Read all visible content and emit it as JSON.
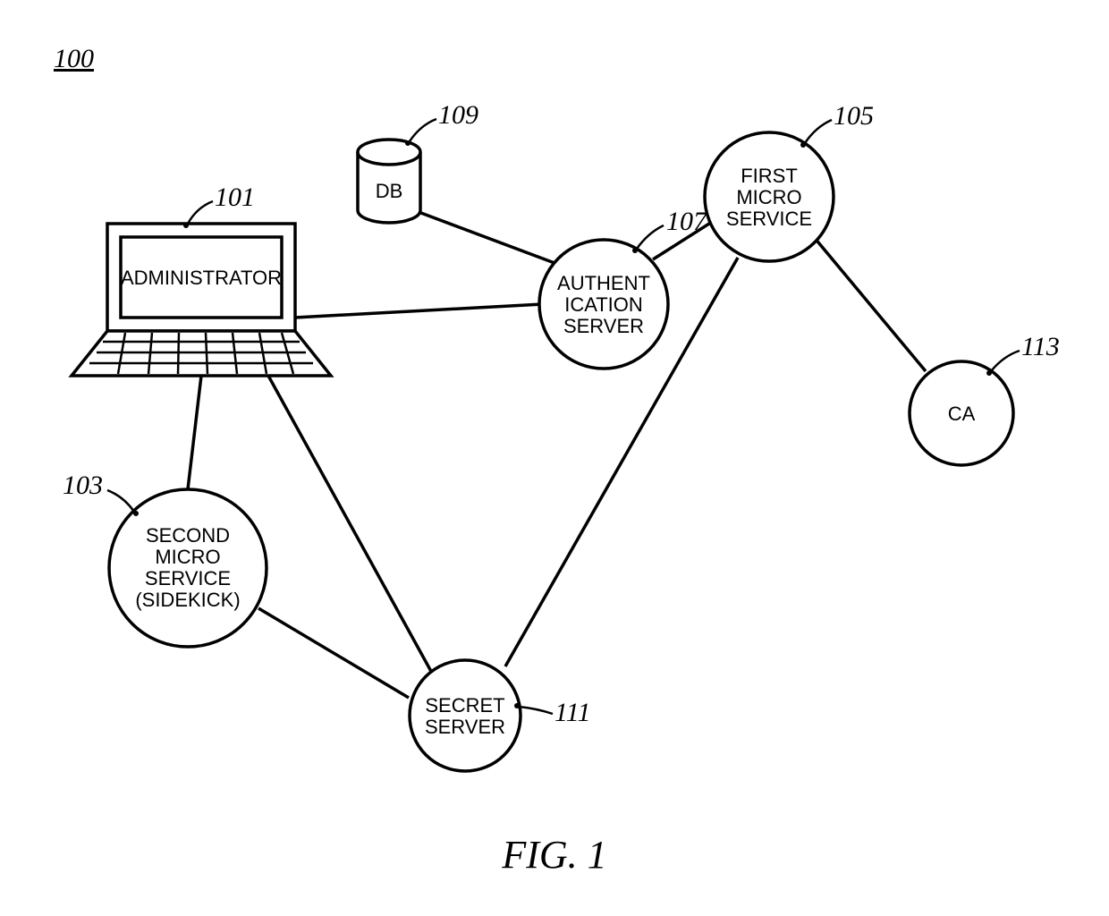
{
  "figure": {
    "number_ref": "100",
    "caption": "FIG. 1"
  },
  "nodes": {
    "administrator": {
      "ref": "101",
      "label": "ADMINISTRATOR"
    },
    "second_micro": {
      "ref": "103",
      "line1": "SECOND",
      "line2": "MICRO",
      "line3": "SERVICE",
      "line4": "(SIDEKICK)"
    },
    "first_micro": {
      "ref": "105",
      "line1": "FIRST",
      "line2": "MICRO",
      "line3": "SERVICE"
    },
    "auth_server": {
      "ref": "107",
      "line1": "AUTHENT",
      "line2": "ICATION",
      "line3": "SERVER"
    },
    "db": {
      "ref": "109",
      "label": "DB"
    },
    "secret_server": {
      "ref": "111",
      "line1": "SECRET",
      "line2": "SERVER"
    },
    "ca": {
      "ref": "113",
      "label": "CA"
    }
  }
}
